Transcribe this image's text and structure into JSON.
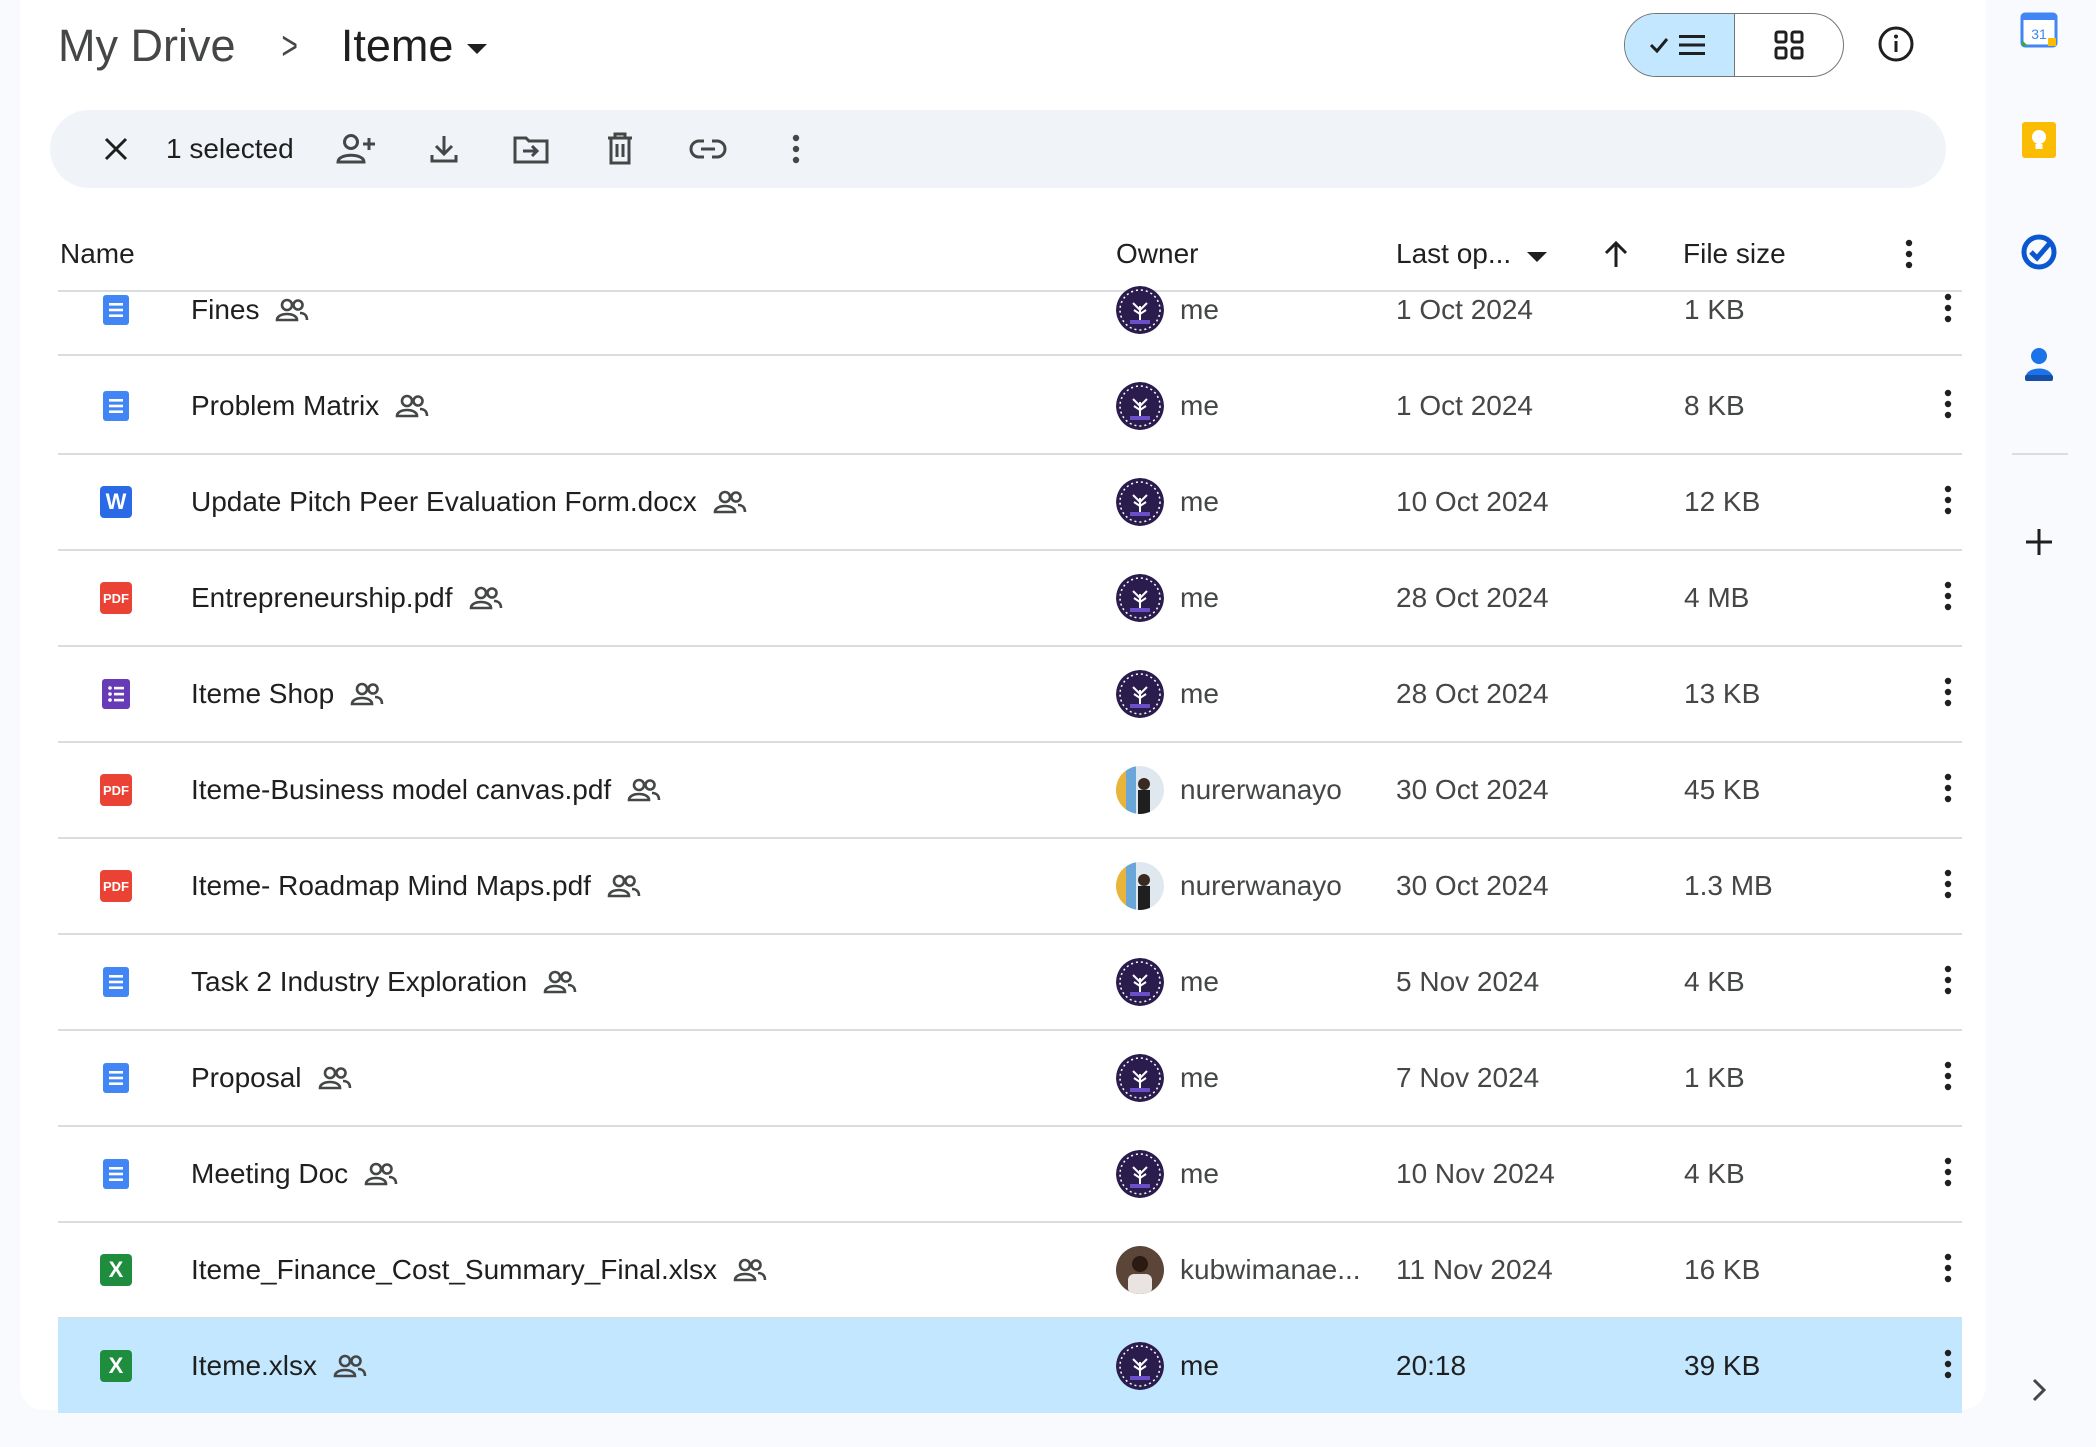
{
  "breadcrumb": {
    "root": "My Drive",
    "current": "Iteme"
  },
  "toolbar": {
    "selected_label": "1 selected"
  },
  "columns": {
    "name": "Name",
    "owner": "Owner",
    "last_opened": "Last op...",
    "file_size": "File size"
  },
  "colors": {
    "selected_row": "#c2e7ff",
    "docs": "#4285f4",
    "word": "#2b6ae6",
    "pdf": "#ea4335",
    "forms": "#673ab7",
    "sheets": "#1e8e3e"
  },
  "files": [
    {
      "name": "Fines",
      "type": "doc",
      "owner": "me",
      "last_opened": "1 Oct 2024",
      "size": "1 KB"
    },
    {
      "name": "Problem Matrix",
      "type": "doc",
      "owner": "me",
      "last_opened": "1 Oct 2024",
      "size": "8 KB"
    },
    {
      "name": "Update Pitch Peer Evaluation Form.docx",
      "type": "word",
      "icon_letter": "W",
      "owner": "me",
      "last_opened": "10 Oct 2024",
      "size": "12 KB"
    },
    {
      "name": "Entrepreneurship.pdf",
      "type": "pdf",
      "icon_letter": "PDF",
      "owner": "me",
      "last_opened": "28 Oct 2024",
      "size": "4 MB"
    },
    {
      "name": "Iteme Shop",
      "type": "form",
      "owner": "me",
      "last_opened": "28 Oct 2024",
      "size": "13 KB"
    },
    {
      "name": "Iteme-Business model canvas.pdf",
      "type": "pdf",
      "icon_letter": "PDF",
      "owner": "nurerwanayo",
      "last_opened": "30 Oct 2024",
      "size": "45 KB"
    },
    {
      "name": "Iteme- Roadmap Mind Maps.pdf",
      "type": "pdf",
      "icon_letter": "PDF",
      "owner": "nurerwanayo",
      "last_opened": "30 Oct 2024",
      "size": "1.3 MB"
    },
    {
      "name": "Task 2 Industry Exploration",
      "type": "doc",
      "owner": "me",
      "last_opened": "5 Nov 2024",
      "size": "4 KB"
    },
    {
      "name": "Proposal",
      "type": "doc",
      "owner": "me",
      "last_opened": "7 Nov 2024",
      "size": "1 KB"
    },
    {
      "name": "Meeting Doc",
      "type": "doc",
      "owner": "me",
      "last_opened": "10 Nov 2024",
      "size": "4 KB"
    },
    {
      "name": "Iteme_Finance_Cost_Summary_Final.xlsx",
      "type": "sheet",
      "icon_letter": "X",
      "owner": "kubwimanae...",
      "last_opened": "11 Nov 2024",
      "size": "16 KB"
    },
    {
      "name": "Iteme.xlsx",
      "type": "sheet",
      "icon_letter": "X",
      "owner": "me",
      "last_opened": "20:18",
      "size": "39 KB",
      "selected": true
    }
  ],
  "side_panel": {
    "calendar_day": "31",
    "apps": [
      "google-calendar-icon",
      "google-keep-icon",
      "google-tasks-icon",
      "google-contacts-icon",
      "add-icon",
      "chevron-right-icon"
    ]
  }
}
